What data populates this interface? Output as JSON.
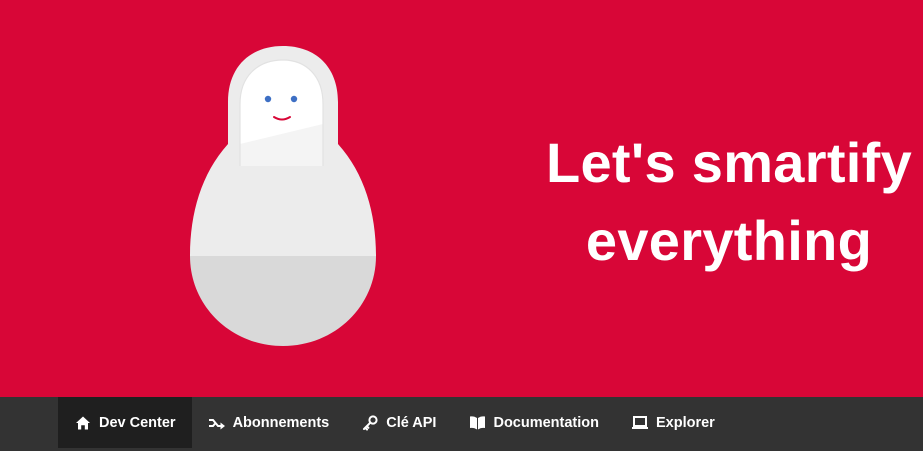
{
  "hero": {
    "tagline_line1": "Let's smartify",
    "tagline_line2": "everything",
    "background_color": "#d80637",
    "illustration": "matryoshka-doll"
  },
  "nav": {
    "items": [
      {
        "label": "Dev Center",
        "icon": "home-icon",
        "active": true
      },
      {
        "label": "Abonnements",
        "icon": "shuffle-icon",
        "active": false
      },
      {
        "label": "Clé API",
        "icon": "key-icon",
        "active": false
      },
      {
        "label": "Documentation",
        "icon": "book-icon",
        "active": false
      },
      {
        "label": "Explorer",
        "icon": "laptop-icon",
        "active": false
      }
    ]
  }
}
